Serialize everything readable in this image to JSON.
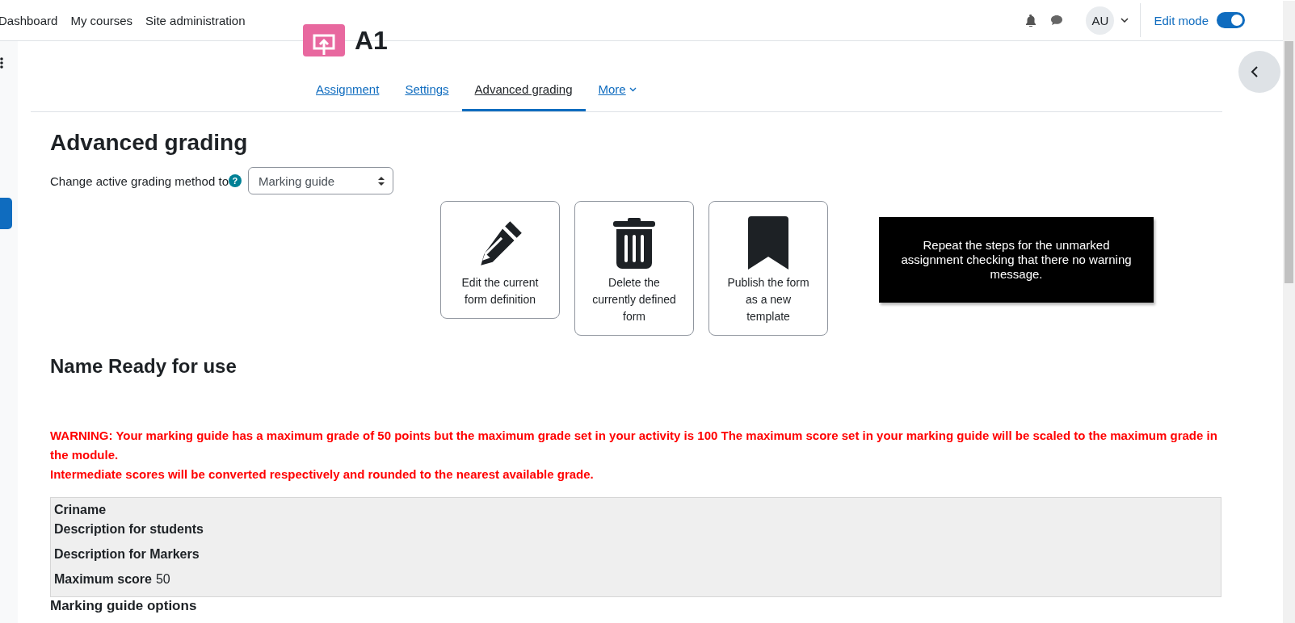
{
  "navbar": {
    "links": [
      {
        "label": "Dashboard"
      },
      {
        "label": "My courses"
      },
      {
        "label": "Site administration"
      }
    ],
    "avatar": "AU",
    "edit_mode": {
      "label": "Edit mode",
      "on": true
    }
  },
  "activity": {
    "title": "A1"
  },
  "tabs": [
    {
      "label": "Assignment",
      "selected": false,
      "kind": "link"
    },
    {
      "label": "Settings",
      "selected": false,
      "kind": "link"
    },
    {
      "label": "Advanced grading",
      "selected": true,
      "kind": "link"
    },
    {
      "label": "More",
      "selected": false,
      "kind": "menu"
    }
  ],
  "page_title": "Advanced grading",
  "method": {
    "label": "Change active grading method to",
    "help": "?",
    "value": "Marking guide"
  },
  "actions": [
    {
      "kind": "edit",
      "label": "Edit the current form definition"
    },
    {
      "kind": "delete",
      "label": "Delete the currently defined form"
    },
    {
      "kind": "publish",
      "label": "Publish the form as a new template"
    }
  ],
  "note": "Repeat the steps for the unmarked assignment checking that there no warning message.",
  "definition_title": "Name Ready for use",
  "warning": [
    "WARNING: Your marking guide has a maximum grade of 50 points but the maximum grade set in your activity is 100 The maximum score set in your marking guide will be scaled to the maximum grade in the module.",
    "Intermediate scores will be converted respectively and rounded to the nearest available grade."
  ],
  "guide": {
    "criterion": "Criname",
    "fields": [
      {
        "label": "Description for students"
      },
      {
        "label": "Description for Markers"
      },
      {
        "label": "Maximum score",
        "value": "50"
      }
    ]
  },
  "options_title": "Marking guide options"
}
